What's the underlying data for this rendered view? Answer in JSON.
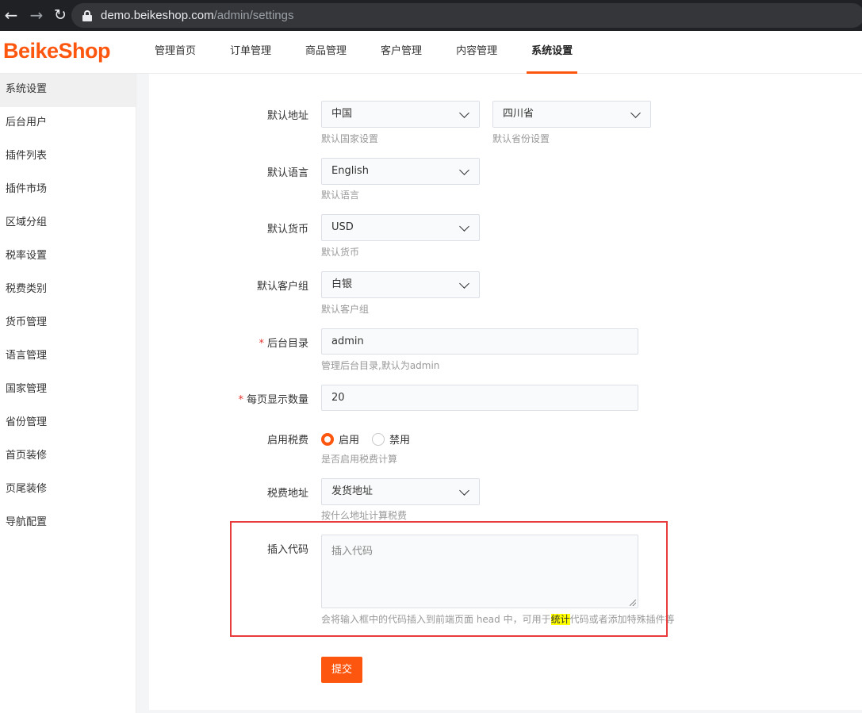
{
  "browser": {
    "url_domain": "demo.beikeshop.com",
    "url_path": "/admin/settings"
  },
  "app": {
    "logo": "BeikeShop"
  },
  "top_nav": [
    "管理首页",
    "订单管理",
    "商品管理",
    "客户管理",
    "内容管理",
    "系统设置"
  ],
  "top_nav_active": "系统设置",
  "sidebar": [
    "系统设置",
    "后台用户",
    "插件列表",
    "插件市场",
    "区域分组",
    "税率设置",
    "税费类别",
    "货币管理",
    "语言管理",
    "国家管理",
    "省份管理",
    "首页装修",
    "页尾装修",
    "导航配置"
  ],
  "sidebar_active": "系统设置",
  "form": {
    "default_address": {
      "label": "默认地址",
      "country": "中国",
      "country_help": "默认国家设置",
      "province": "四川省",
      "province_help": "默认省份设置"
    },
    "default_language": {
      "label": "默认语言",
      "value": "English",
      "help": "默认语言"
    },
    "default_currency": {
      "label": "默认货币",
      "value": "USD",
      "help": "默认货币"
    },
    "default_customer_group": {
      "label": "默认客户组",
      "value": "白银",
      "help": "默认客户组"
    },
    "admin_dir": {
      "required": "*",
      "label": "后台目录",
      "value": "admin",
      "help": "管理后台目录,默认为admin"
    },
    "per_page": {
      "required": "*",
      "label": "每页显示数量",
      "value": "20"
    },
    "tax": {
      "label": "启用税费",
      "option_on": "启用",
      "option_off": "禁用",
      "selected": "启用",
      "help": "是否启用税费计算"
    },
    "tax_address": {
      "label": "税费地址",
      "value": "发货地址",
      "help": "按什么地址计算税费"
    },
    "head_code": {
      "label": "插入代码",
      "placeholder": "插入代码",
      "help_before": "会将输入框中的代码插入到前端页面 head 中，可用于",
      "help_highlight": "统计",
      "help_after": "代码或者添加特殊插件等"
    },
    "submit": "提交"
  },
  "colors": {
    "brand": "#fd560f",
    "annotation_box": "#e83b3b",
    "highlight": "#ffff00"
  }
}
